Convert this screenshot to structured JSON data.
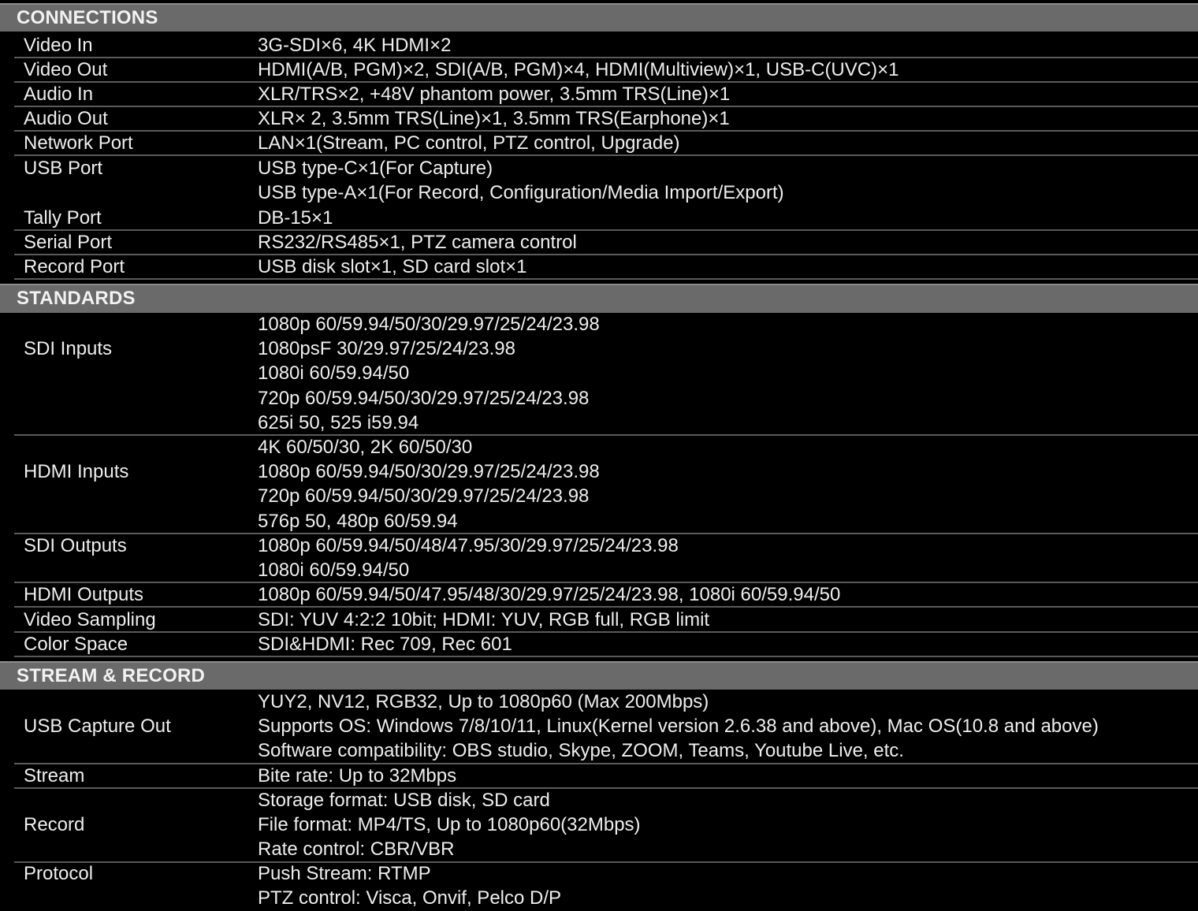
{
  "sections": [
    {
      "title": "CONNECTIONS",
      "rows": [
        {
          "label": "Video In",
          "values": [
            "3G-SDI×6, 4K HDMI×2"
          ]
        },
        {
          "label": "Video Out",
          "values": [
            "HDMI(A/B, PGM)×2, SDI(A/B, PGM)×4, HDMI(Multiview)×1, USB-C(UVC)×1"
          ]
        },
        {
          "label": "Audio In",
          "values": [
            "XLR/TRS×2, +48V phantom power, 3.5mm TRS(Line)×1"
          ]
        },
        {
          "label": "Audio Out",
          "values": [
            "XLR× 2, 3.5mm TRS(Line)×1, 3.5mm TRS(Earphone)×1"
          ]
        },
        {
          "label": "Network Port",
          "values": [
            "LAN×1(Stream, PC control, PTZ control, Upgrade)"
          ]
        },
        {
          "label": "USB Port",
          "values": [
            "USB type-C×1(For Capture)",
            "USB type-A×1(For Record, Configuration/Media Import/Export)"
          ]
        },
        {
          "label": "Tally Port",
          "values": [
            "DB-15×1"
          ]
        },
        {
          "label": "Serial Port",
          "values": [
            "RS232/RS485×1, PTZ camera control"
          ]
        },
        {
          "label": "Record Port",
          "values": [
            "USB disk slot×1, SD card slot×1"
          ]
        }
      ]
    },
    {
      "title": "STANDARDS",
      "rows": [
        {
          "label": "SDI Inputs",
          "values": [
            "1080p 60/59.94/50/30/29.97/25/24/23.98",
            "1080psF 30/29.97/25/24/23.98",
            "1080i 60/59.94/50",
            "720p 60/59.94/50/30/29.97/25/24/23.98",
            "625i 50, 525 i59.94"
          ]
        },
        {
          "label": "HDMI Inputs",
          "values": [
            "4K 60/50/30, 2K 60/50/30",
            "1080p 60/59.94/50/30/29.97/25/24/23.98",
            "720p 60/59.94/50/30/29.97/25/24/23.98",
            "576p 50, 480p 60/59.94"
          ]
        },
        {
          "label": "SDI Outputs",
          "values": [
            "1080p 60/59.94/50/48/47.95/30/29.97/25/24/23.98",
            "1080i 60/59.94/50"
          ]
        },
        {
          "label": "HDMI Outputs",
          "values": [
            "1080p 60/59.94/50/47.95/48/30/29.97/25/24/23.98, 1080i 60/59.94/50"
          ]
        },
        {
          "label": "Video Sampling",
          "values": [
            "SDI: YUV 4:2:2 10bit; HDMI: YUV, RGB full, RGB limit"
          ]
        },
        {
          "label": "Color Space",
          "values": [
            "SDI&HDMI: Rec 709, Rec 601"
          ]
        }
      ]
    },
    {
      "title": "STREAM & RECORD",
      "rows": [
        {
          "label": "USB Capture Out",
          "values": [
            "YUY2, NV12, RGB32, Up to 1080p60 (Max 200Mbps)",
            "Supports OS: Windows 7/8/10/11, Linux(Kernel version 2.6.38 and above), Mac OS(10.8 and above)",
            "Software compatibility: OBS studio, Skype, ZOOM, Teams, Youtube Live, etc."
          ]
        },
        {
          "label": "Stream",
          "values": [
            "Bite rate: Up to 32Mbps"
          ]
        },
        {
          "label": "Record",
          "values": [
            "Storage format: USB disk, SD card",
            "File format: MP4/TS, Up to 1080p60(32Mbps)",
            "Rate control: CBR/VBR"
          ]
        },
        {
          "label": "Protocol",
          "values": [
            "Push Stream: RTMP",
            "PTZ control: Visca, Onvif, Pelco D/P"
          ]
        }
      ]
    }
  ]
}
